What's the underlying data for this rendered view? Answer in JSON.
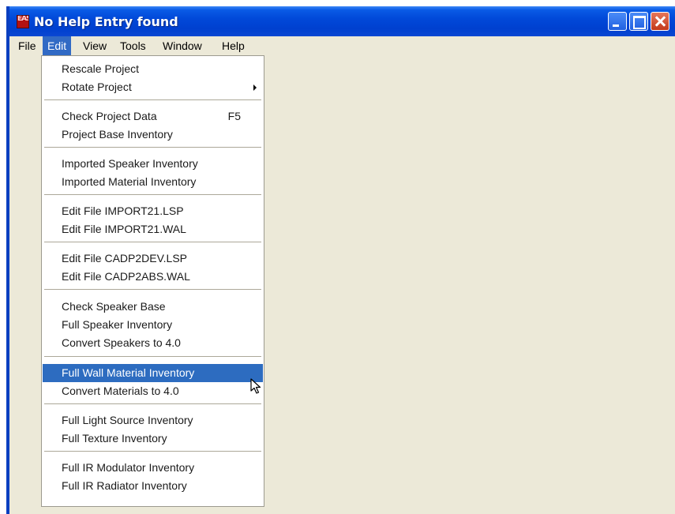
{
  "window": {
    "title": "No Help Entry found"
  },
  "icons": {
    "app": "app-logo-icon",
    "minimize": "minimize-icon",
    "maximize": "maximize-icon",
    "close": "close-icon",
    "submenu": "submenu-arrow-icon",
    "cursor": "mouse-pointer-icon"
  },
  "colors": {
    "titlebar": "#0149d9",
    "menu_highlight": "#316ac5",
    "selected_item": "#2d6cc0",
    "close_button": "#d24b2a"
  },
  "menubar": {
    "items": [
      "File",
      "Edit",
      "View",
      "Tools",
      "Window",
      "Help"
    ],
    "active": "Edit"
  },
  "edit_menu": {
    "items": [
      {
        "label": "Rescale Project"
      },
      {
        "label": "Rotate Project",
        "submenu": true
      },
      {
        "label": "Check Project Data",
        "shortcut": "F5"
      },
      {
        "label": "Project Base Inventory"
      },
      {
        "label": "Imported Speaker Inventory"
      },
      {
        "label": "Imported Material Inventory"
      },
      {
        "label": "Edit File IMPORT21.LSP"
      },
      {
        "label": "Edit File IMPORT21.WAL"
      },
      {
        "label": "Edit File CADP2DEV.LSP"
      },
      {
        "label": "Edit File CADP2ABS.WAL"
      },
      {
        "label": "Check Speaker Base"
      },
      {
        "label": "Full Speaker Inventory"
      },
      {
        "label": "Convert Speakers to 4.0"
      },
      {
        "label": "Full Wall Material Inventory",
        "selected": true
      },
      {
        "label": "Convert Materials to 4.0"
      },
      {
        "label": "Full Light Source Inventory"
      },
      {
        "label": "Full Texture Inventory"
      },
      {
        "label": "Full IR Modulator Inventory"
      },
      {
        "label": "Full IR Radiator Inventory"
      }
    ]
  }
}
